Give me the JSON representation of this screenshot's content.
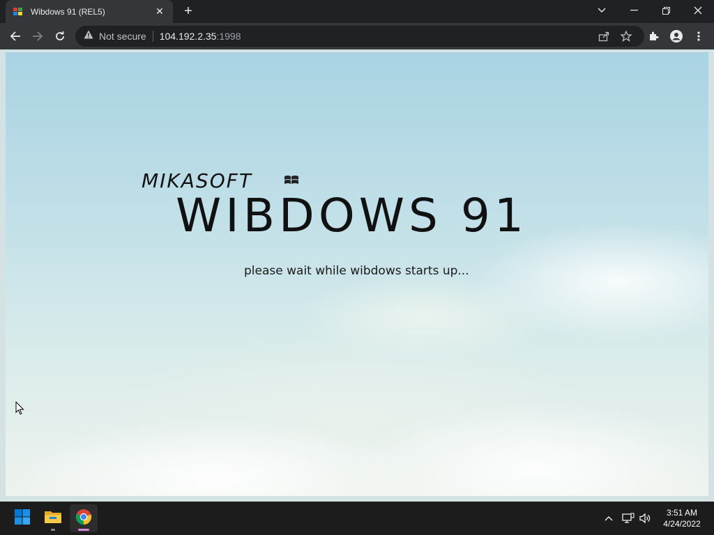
{
  "browser": {
    "tab": {
      "title": "Wibdows 91 (REL5)",
      "favicon": "wibdows-favicon",
      "close_glyph": "✕"
    },
    "new_tab_glyph": "+",
    "window_controls": {
      "chevron": "chevron-down-icon",
      "minimize": "minimize-icon",
      "restore": "restore-icon",
      "close": "close-icon"
    },
    "address_bar": {
      "security_label": "Not secure",
      "host": "104.192.2.35",
      "port": ":1998"
    }
  },
  "page": {
    "publisher": "MIKASOFT",
    "product": "WIBDOWS 91",
    "status": "please wait while wibdows starts up..."
  },
  "taskbar": {
    "apps": [
      "start-icon",
      "file-explorer-icon",
      "chrome-icon"
    ],
    "clock": {
      "time": "3:51 AM",
      "date": "4/24/2022"
    }
  },
  "colors": {
    "browser_bg": "#202124",
    "toolbar_bg": "#35363a",
    "taskbar_bg": "#1c1c1c",
    "windows_blue": "#0078d4",
    "folder_yellow": "#f7c948"
  }
}
